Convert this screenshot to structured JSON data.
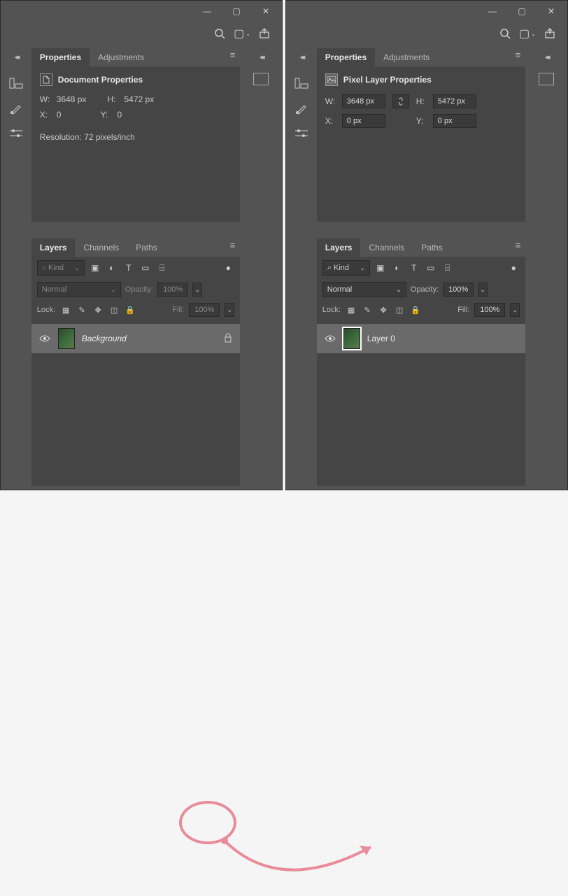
{
  "left": {
    "tabs": {
      "properties": "Properties",
      "adjustments": "Adjustments"
    },
    "props": {
      "title": "Document Properties",
      "w_label": "W:",
      "w_value": "3648 px",
      "h_label": "H:",
      "h_value": "5472 px",
      "x_label": "X:",
      "x_value": "0",
      "y_label": "Y:",
      "y_value": "0",
      "resolution": "Resolution: 72 pixels/inch"
    },
    "layers_tabs": {
      "layers": "Layers",
      "channels": "Channels",
      "paths": "Paths"
    },
    "layers": {
      "kind_prefix": "Kind",
      "blend_mode": "Normal",
      "opacity_label": "Opacity:",
      "opacity_value": "100%",
      "lock_label": "Lock:",
      "fill_label": "Fill:",
      "fill_value": "100%",
      "layer_name": "Background"
    }
  },
  "right": {
    "tabs": {
      "properties": "Properties",
      "adjustments": "Adjustments"
    },
    "props": {
      "title": "Pixel Layer Properties",
      "w_label": "W:",
      "w_value": "3648 px",
      "h_label": "H:",
      "h_value": "5472 px",
      "x_label": "X:",
      "x_value": "0 px",
      "y_label": "Y:",
      "y_value": "0 px"
    },
    "layers_tabs": {
      "layers": "Layers",
      "channels": "Channels",
      "paths": "Paths"
    },
    "layers": {
      "kind_prefix": "Kind",
      "blend_mode": "Normal",
      "opacity_label": "Opacity:",
      "opacity_value": "100%",
      "lock_label": "Lock:",
      "fill_label": "Fill:",
      "fill_value": "100%",
      "layer_name": "Layer 0"
    }
  },
  "glyphs": {
    "search": "⌕",
    "chevdown": "⌄",
    "menu": "≡",
    "eye": "◉",
    "lock": "🔒",
    "image": "▣",
    "adjust": "◐",
    "type": "T",
    "shape": "▭",
    "smart": "⌸",
    "pixel": "▦",
    "link": "⧉",
    "move": "✥",
    "crop": "◫",
    "brush": "✎",
    "ruler": "⊞",
    "swap": "⇆",
    "share": "⇪",
    "docstack": "▢"
  }
}
